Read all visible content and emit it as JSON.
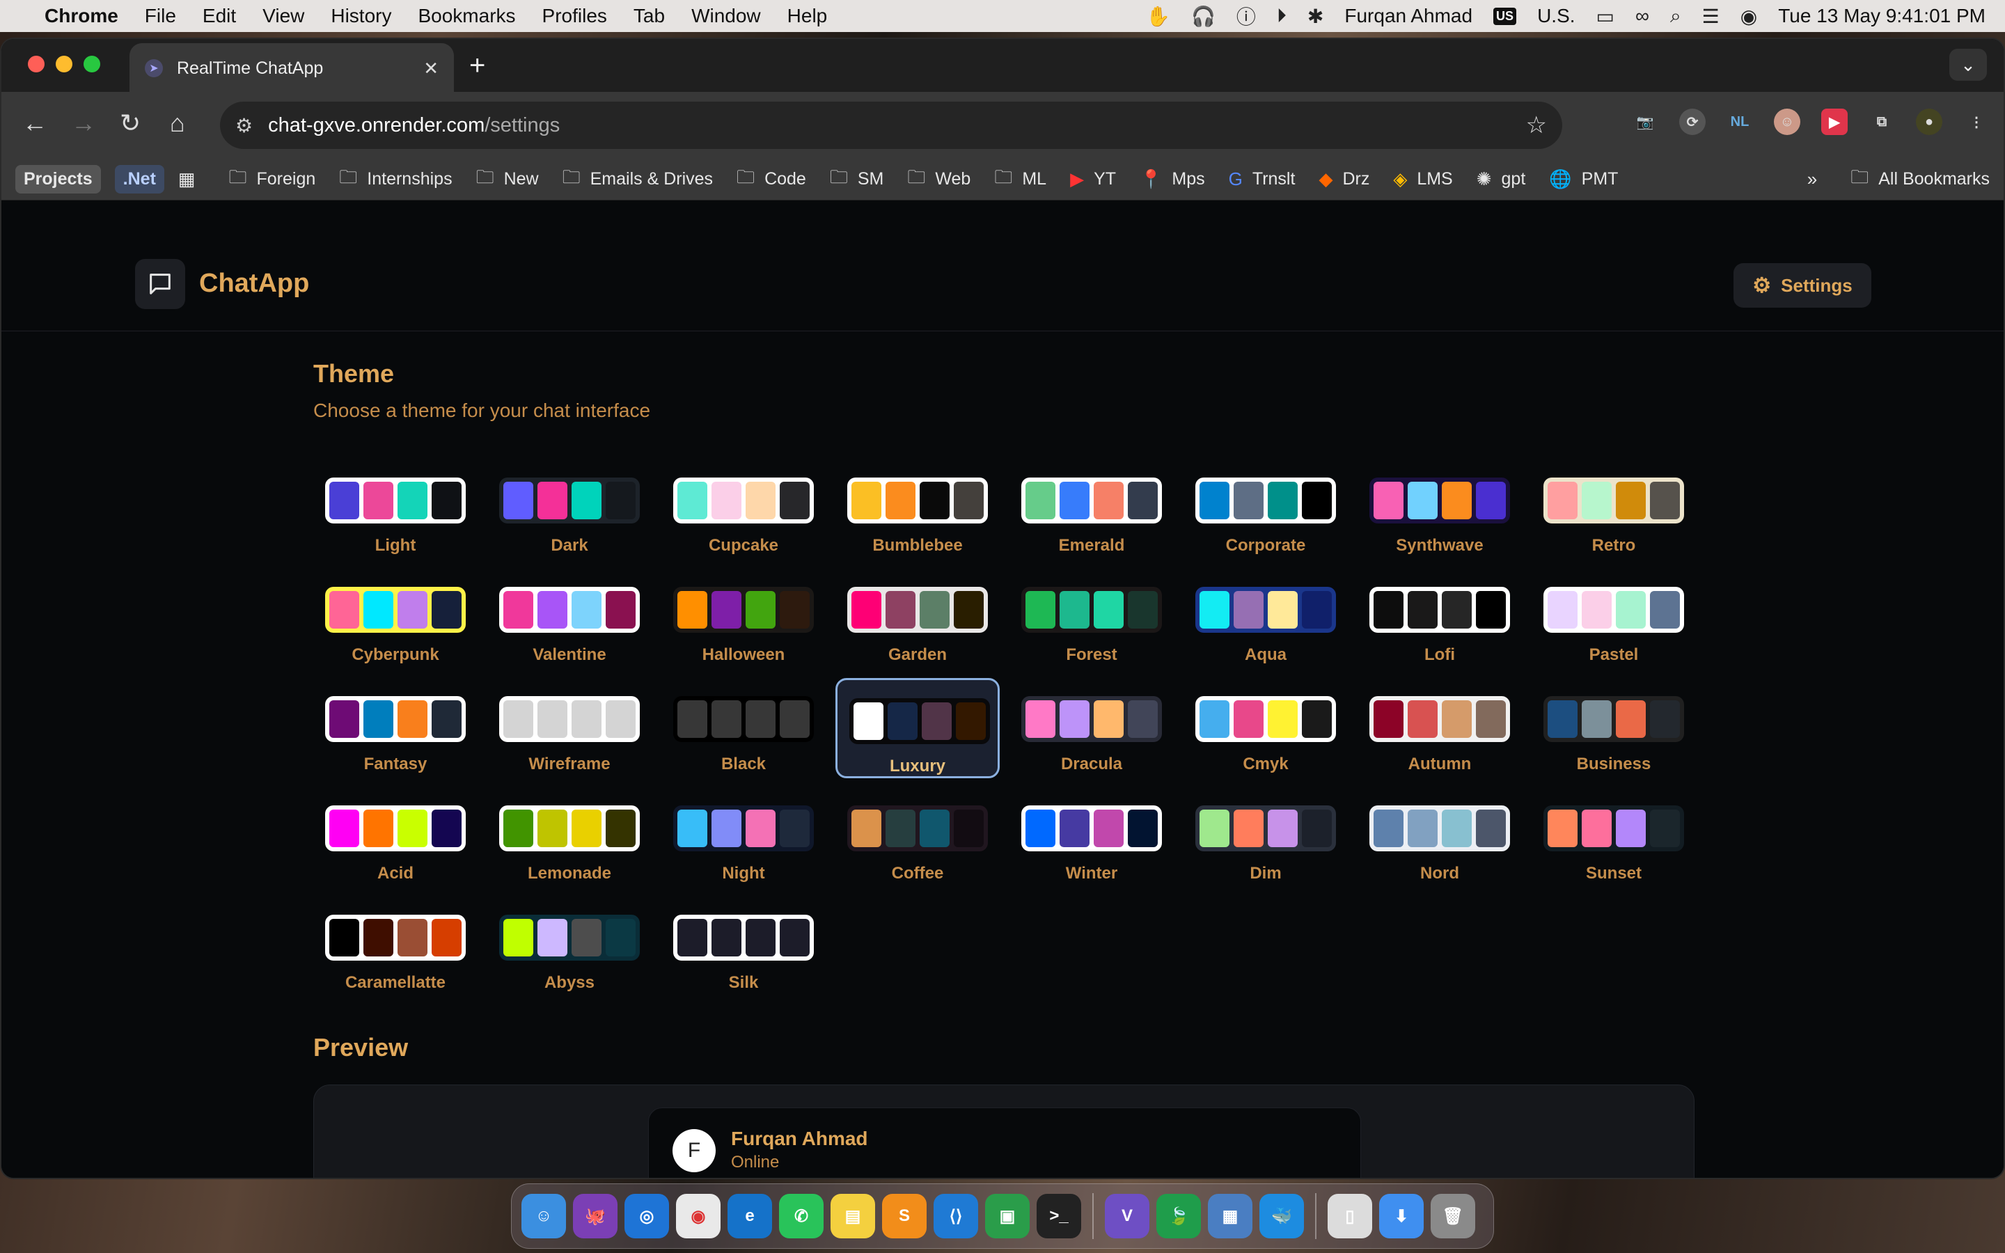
{
  "menubar": {
    "app_name": "Chrome",
    "items": [
      "File",
      "Edit",
      "View",
      "History",
      "Bookmarks",
      "Profiles",
      "Tab",
      "Window",
      "Help"
    ],
    "user": "Furqan Ahmad",
    "input_source": "U.S.",
    "input_badge": "US",
    "datetime": "Tue 13 May  9:41:01 PM"
  },
  "browser": {
    "tab_title": "RealTime ChatApp",
    "url_host": "chat-gxve.onrender.com",
    "url_path": "/settings",
    "bookmarks": [
      "Projects",
      ".Net",
      "Foreign",
      "Internships",
      "New",
      "Emails & Drives",
      "Code",
      "SM",
      "Web",
      "ML",
      "YT",
      "Mps",
      "Trnslt",
      "Drz",
      "LMS",
      "gpt",
      "PMT"
    ],
    "all_bookmarks": "All Bookmarks",
    "ext_badge": "NL"
  },
  "app": {
    "brand": "ChatApp",
    "settings_label": "Settings",
    "theme_title": "Theme",
    "theme_subtitle": "Choose a theme for your chat interface",
    "preview_title": "Preview",
    "preview_contact": {
      "initial": "F",
      "name": "Furqan Ahmad",
      "status": "Online"
    }
  },
  "selected_theme": "Luxury",
  "themes": [
    {
      "name": "Light",
      "bg": "#ffffff",
      "colors": [
        "#4a3fd6",
        "#ec4899",
        "#14d4b8",
        "#0f1115"
      ]
    },
    {
      "name": "Dark",
      "bg": "#1d232a",
      "colors": [
        "#605dff",
        "#f43098",
        "#00d3bb",
        "#15191e"
      ]
    },
    {
      "name": "Cupcake",
      "bg": "#ffffff",
      "colors": [
        "#5eead4",
        "#fbcfe8",
        "#fed7aa",
        "#27272a"
      ]
    },
    {
      "name": "Bumblebee",
      "bg": "#ffffff",
      "colors": [
        "#fbbf24",
        "#fb8c1e",
        "#0a0a0a",
        "#44403c"
      ]
    },
    {
      "name": "Emerald",
      "bg": "#ffffff",
      "colors": [
        "#66cc8a",
        "#377cfb",
        "#f68067",
        "#333c4d"
      ]
    },
    {
      "name": "Corporate",
      "bg": "#ffffff",
      "colors": [
        "#0082ce",
        "#5e6e85",
        "#00908a",
        "#000000"
      ]
    },
    {
      "name": "Synthwave",
      "bg": "#1a103d",
      "colors": [
        "#f861b4",
        "#71d1fe",
        "#fb8c1e",
        "#4a2fd0"
      ]
    },
    {
      "name": "Retro",
      "bg": "#ece3ca",
      "colors": [
        "#ff9fa0",
        "#b7f6cd",
        "#d08b0b",
        "#56524c"
      ]
    },
    {
      "name": "Cyberpunk",
      "bg": "#fff248",
      "colors": [
        "#ff6596",
        "#00e8ff",
        "#c07eec",
        "#16203a"
      ]
    },
    {
      "name": "Valentine",
      "bg": "#ffffff",
      "colors": [
        "#f0389b",
        "#a855f7",
        "#7dd3fc",
        "#8a1150"
      ]
    },
    {
      "name": "Halloween",
      "bg": "#1b1816",
      "colors": [
        "#ff8f00",
        "#7e1fa8",
        "#42a50f",
        "#2d1a0e"
      ]
    },
    {
      "name": "Garden",
      "bg": "#e9e7e7",
      "colors": [
        "#fe0075",
        "#8e4162",
        "#5c7f67",
        "#291e00"
      ]
    },
    {
      "name": "Forest",
      "bg": "#1b1717",
      "colors": [
        "#1eb854",
        "#1db88e",
        "#1fd6a4",
        "#19362d"
      ]
    },
    {
      "name": "Aqua",
      "bg": "#1a368b",
      "colors": [
        "#13ecf3",
        "#966fb3",
        "#ffe999",
        "#10206a"
      ]
    },
    {
      "name": "Lofi",
      "bg": "#ffffff",
      "colors": [
        "#0d0d0d",
        "#1a1919",
        "#262626",
        "#000000"
      ]
    },
    {
      "name": "Pastel",
      "bg": "#ffffff",
      "colors": [
        "#e9d4ff",
        "#fbcfe8",
        "#a7f3d0",
        "#5d7392"
      ]
    },
    {
      "name": "Fantasy",
      "bg": "#ffffff",
      "colors": [
        "#6e0b75",
        "#007ebd",
        "#f97f1c",
        "#1f2937"
      ]
    },
    {
      "name": "Wireframe",
      "bg": "#ffffff",
      "colors": [
        "#d4d4d4",
        "#d4d4d4",
        "#d4d4d4",
        "#d4d4d4"
      ]
    },
    {
      "name": "Black",
      "bg": "#000000",
      "colors": [
        "#373737",
        "#373737",
        "#373737",
        "#373737"
      ]
    },
    {
      "name": "Luxury",
      "bg": "#09090b",
      "colors": [
        "#ffffff",
        "#152747",
        "#513448",
        "#331800"
      ]
    },
    {
      "name": "Dracula",
      "bg": "#282a36",
      "colors": [
        "#ff79c6",
        "#bd93f9",
        "#ffb86c",
        "#414558"
      ]
    },
    {
      "name": "Cmyk",
      "bg": "#ffffff",
      "colors": [
        "#45aeee",
        "#e8488a",
        "#fff232",
        "#1a1a1a"
      ]
    },
    {
      "name": "Autumn",
      "bg": "#f1f1f1",
      "colors": [
        "#8c0327",
        "#d85251",
        "#d59b6a",
        "#826a5c"
      ]
    },
    {
      "name": "Business",
      "bg": "#202020",
      "colors": [
        "#1c4e80",
        "#7c909a",
        "#ea6947",
        "#23282e"
      ]
    },
    {
      "name": "Acid",
      "bg": "#ffffff",
      "colors": [
        "#ff00f4",
        "#ff7400",
        "#c9ff00",
        "#140651"
      ]
    },
    {
      "name": "Lemonade",
      "bg": "#ffffff",
      "colors": [
        "#419400",
        "#bfc400",
        "#e9d000",
        "#343300"
      ]
    },
    {
      "name": "Night",
      "bg": "#0f172a",
      "colors": [
        "#38bdf8",
        "#818cf8",
        "#f471b5",
        "#1e293b"
      ]
    },
    {
      "name": "Coffee",
      "bg": "#20161f",
      "colors": [
        "#db924b",
        "#263e3f",
        "#10576d",
        "#120c12"
      ]
    },
    {
      "name": "Winter",
      "bg": "#ffffff",
      "colors": [
        "#0069ff",
        "#463aa2",
        "#c148ac",
        "#021431"
      ]
    },
    {
      "name": "Dim",
      "bg": "#2a303c",
      "colors": [
        "#9fe88d",
        "#ff7d5c",
        "#c792e9",
        "#1c212b"
      ]
    },
    {
      "name": "Nord",
      "bg": "#eceff4",
      "colors": [
        "#5e81ac",
        "#81a1c1",
        "#88c0d0",
        "#4c566a"
      ]
    },
    {
      "name": "Sunset",
      "bg": "#121c22",
      "colors": [
        "#ff865b",
        "#fd6f9c",
        "#b387fa",
        "#1b262c"
      ]
    },
    {
      "name": "Caramellatte",
      "bg": "#ffffff",
      "colors": [
        "#000000",
        "#3f0e00",
        "#9a4e34",
        "#d63e00"
      ]
    },
    {
      "name": "Abyss",
      "bg": "#0a2d38",
      "colors": [
        "#c0ff00",
        "#cdb8ff",
        "#4d4d4d",
        "#0b3944"
      ]
    },
    {
      "name": "Silk",
      "bg": "#ffffff",
      "colors": [
        "#1c1c29",
        "#1c1c29",
        "#1c1c29",
        "#1c1c29"
      ]
    }
  ],
  "dock_apps": [
    "Finder",
    "GitHub",
    "Safari",
    "Chrome",
    "Edge",
    "WhatsApp",
    "Notes",
    "Sublime Text",
    "VS Code",
    "Classroom",
    "Terminal",
    "Visual Studio",
    "MongoDB",
    "Azure Data Studio",
    "Docker",
    "Documents",
    "Downloads",
    "Trash"
  ]
}
